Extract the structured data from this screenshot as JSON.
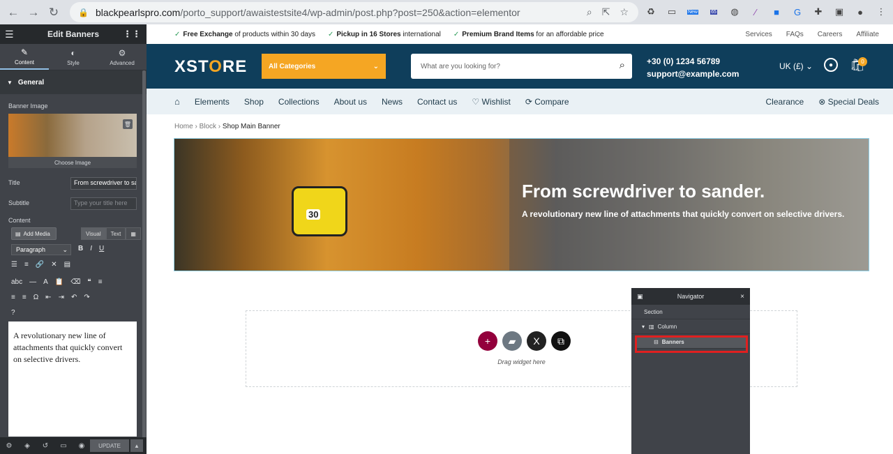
{
  "browser": {
    "url_domain": "blackpearlspro.com",
    "url_path": "/porto_support/awaistestsite4/wp-admin/post.php?post=250&action=elementor",
    "ext_badge_new": "New",
    "ext_badge_count": "65"
  },
  "panel": {
    "title": "Edit Banners",
    "tabs": [
      {
        "label": "Content"
      },
      {
        "label": "Style"
      },
      {
        "label": "Advanced"
      }
    ],
    "section": "General",
    "banner_image_label": "Banner Image",
    "choose_image": "Choose Image",
    "title_label": "Title",
    "title_value": "From screwdriver to sander.",
    "subtitle_label": "Subtitle",
    "subtitle_placeholder": "Type your title here",
    "content_label": "Content",
    "add_media": "Add Media",
    "visual_tab": "Visual",
    "text_tab": "Text",
    "format_select": "Paragraph",
    "editor_text": "A revolutionary new line of attachments that quickly convert on selective drivers.",
    "update": "UPDATE"
  },
  "site": {
    "topbar": [
      {
        "bold": "Free Exchange",
        "rest": " of products within 30 days"
      },
      {
        "bold": "Pickup in 16 Stores",
        "rest": " international"
      },
      {
        "bold": "Premium Brand Items",
        "rest": " for an affordable price"
      }
    ],
    "topbar_links": [
      "Services",
      "FAQs",
      "Careers",
      "Affiliate"
    ],
    "logo_pre": "XST",
    "logo_o": "O",
    "logo_post": "RE",
    "categories": "All Categories",
    "search_placeholder": "What are you looking for?",
    "phone": "+30 (0) 1234 56789",
    "email": "support@example.com",
    "locale": "UK (£)",
    "cart_count": "0",
    "menu": [
      "Elements",
      "Shop",
      "Collections",
      "About us",
      "News",
      "Contact us",
      "Wishlist",
      "Compare"
    ],
    "menu_right": [
      "Clearance",
      "Special Deals"
    ],
    "breadcrumb": [
      "Home",
      "Block",
      "Shop Main Banner"
    ],
    "banner_title": "From screwdriver to sander.",
    "banner_subtitle": "A revolutionary new line of attachments that quickly convert on selective drivers.",
    "tape_number": "30",
    "drag_widget": "Drag widget here"
  },
  "navigator": {
    "title": "Navigator",
    "items": [
      "Section",
      "Column",
      "Banners"
    ]
  },
  "colors": {
    "header_bg": "#0f3e5b",
    "accent": "#f5a623",
    "highlight": "#e02020"
  }
}
